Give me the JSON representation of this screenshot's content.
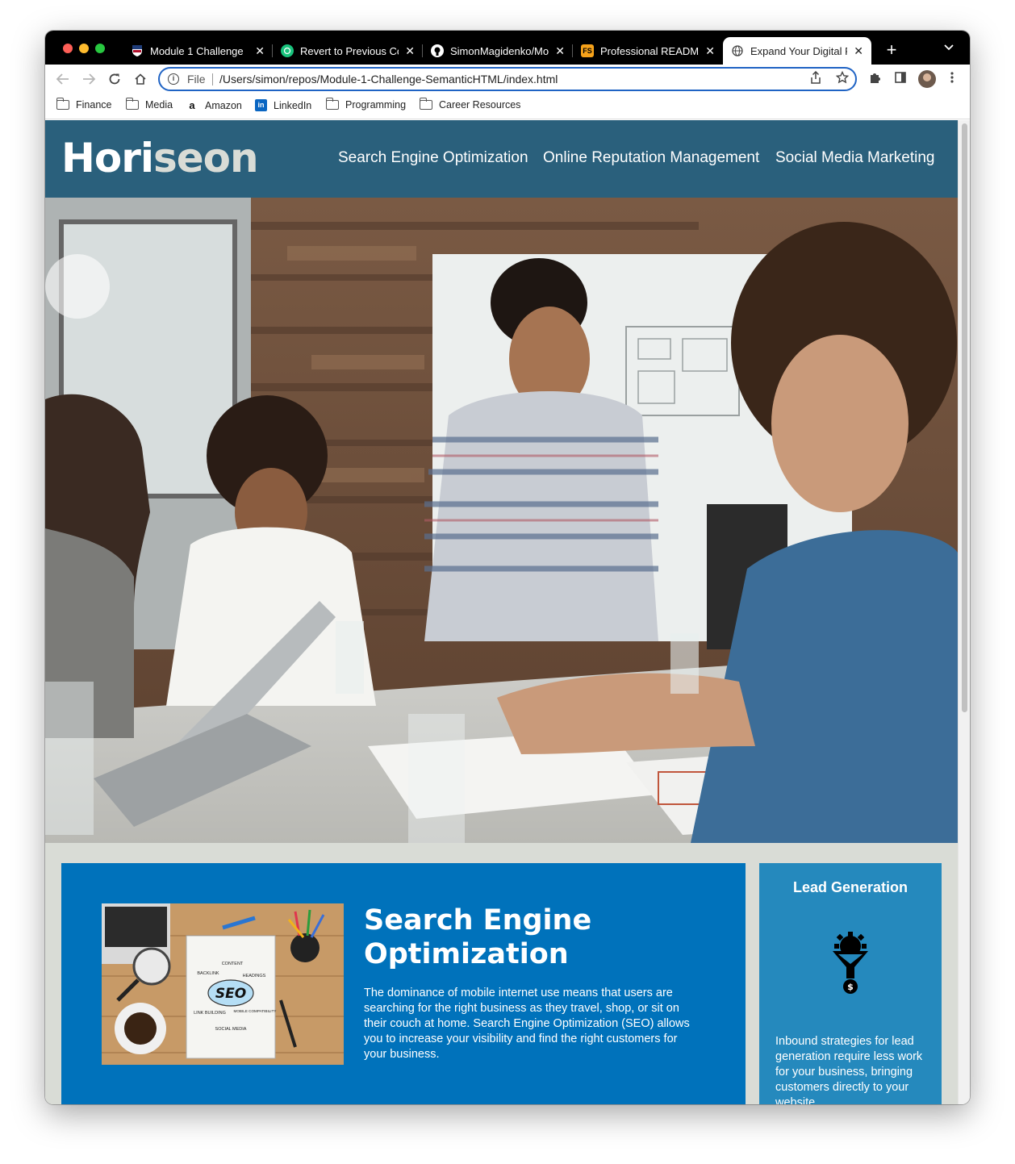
{
  "browser": {
    "tabs": [
      {
        "title": "Module 1 Challenge",
        "favicon": "penn-shield-icon",
        "active": false
      },
      {
        "title": "Revert to Previous Co",
        "favicon": "chatgpt-icon",
        "active": false
      },
      {
        "title": "SimonMagidenko/Mo",
        "favicon": "github-icon",
        "active": false
      },
      {
        "title": "Professional README",
        "favicon": "fs-icon",
        "favicon_text": "FS",
        "active": false
      },
      {
        "title": "Expand Your Digital P",
        "favicon": "globe-icon",
        "active": true
      }
    ],
    "close_glyph": "✕",
    "new_tab_glyph": "+",
    "tab_menu_glyph": "⌄",
    "omnibox": {
      "scheme": "File",
      "url": "/Users/simon/repos/Module-1-Challenge-SemanticHTML/index.html"
    },
    "bookmarks": [
      {
        "label": "Finance",
        "icon": "folder-icon"
      },
      {
        "label": "Media",
        "icon": "folder-icon"
      },
      {
        "label": "Amazon",
        "icon": "amazon-icon"
      },
      {
        "label": "LinkedIn",
        "icon": "linkedin-icon"
      },
      {
        "label": "Programming",
        "icon": "folder-icon"
      },
      {
        "label": "Career Resources",
        "icon": "folder-icon"
      }
    ],
    "colors": {
      "tab_strip": "#000000",
      "omnibox_border": "#1f63c4"
    }
  },
  "site": {
    "logo_part1": "Hori",
    "logo_part2": "seon",
    "nav": [
      "Search Engine Optimization",
      "Online Reputation Management",
      "Social Media Marketing"
    ],
    "content": {
      "heading": "Search Engine Optimization",
      "body": "The dominance of mobile internet use means that users are searching for the right business as they travel, shop, or sit on their couch at home. Search Engine Optimization (SEO) allows you to increase your visibility and find the right customers for your business.",
      "image_words": [
        "CONTENT",
        "BACKLINK",
        "HEADINGS",
        "SEO",
        "LINK BUILDING",
        "MOBILE COMPATIBILITY",
        "SOCIAL MEDIA"
      ]
    },
    "aside": {
      "heading": "Lead Generation",
      "icon": "lead-funnel-icon",
      "body": "Inbound strategies for lead generation require less work for your business, bringing customers directly to your website."
    },
    "colors": {
      "header": "#2a607c",
      "logo_accent": "#d9dcd6",
      "background": "#d9dcd6",
      "content_bg": "#0072bb",
      "aside_bg": "#2589bd"
    }
  }
}
